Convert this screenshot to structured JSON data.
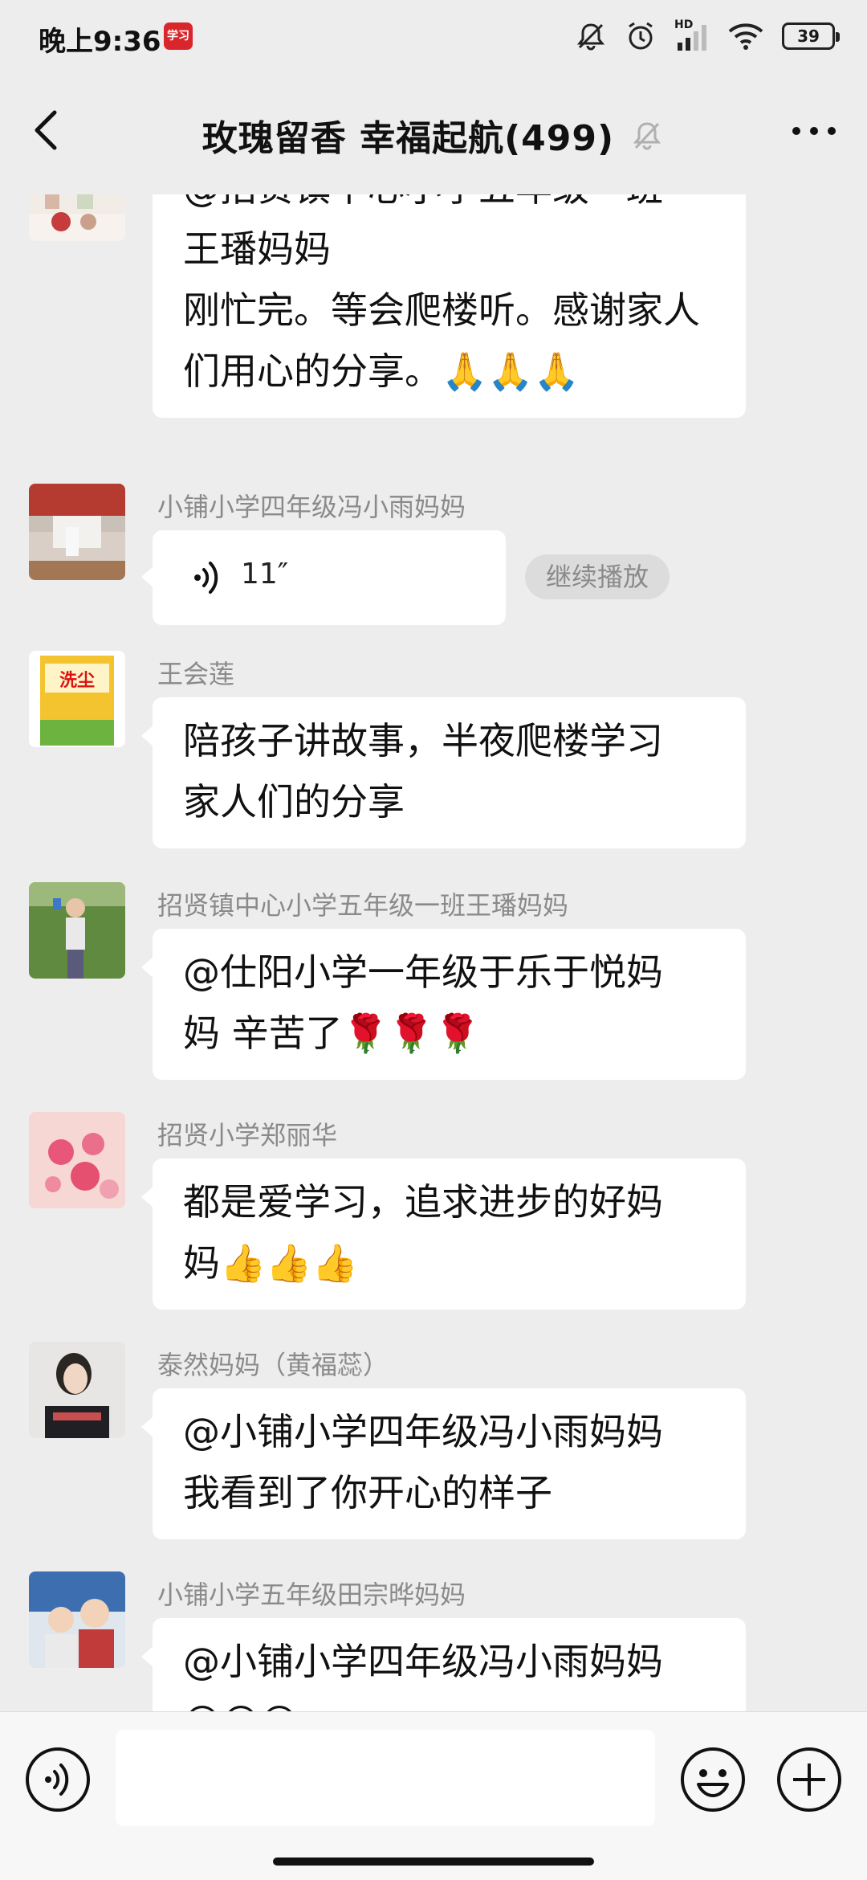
{
  "status_bar": {
    "time": "晚上9:36",
    "app_icon_text": "学习",
    "network_label": "HD",
    "battery": "39"
  },
  "header": {
    "title": "玫瑰留香  幸福起航(499)"
  },
  "messages": [
    {
      "sender": "",
      "lines": [
        "@招贤镇中心小学五年级一班",
        "王璠妈妈",
        "刚忙完。等会爬楼听。感谢家人",
        "们用心的分享。🙏🙏🙏"
      ]
    },
    {
      "sender": "小铺小学四年级冯小雨妈妈",
      "voice_duration": "11″",
      "continue_label": "继续播放"
    },
    {
      "sender": "王会莲",
      "avatar_text": "洗尘",
      "lines": [
        "陪孩子讲故事，半夜爬楼学习",
        "家人们的分享"
      ]
    },
    {
      "sender": "招贤镇中心小学五年级一班王璠妈妈",
      "lines": [
        "@仕阳小学一年级于乐于悦妈",
        "妈  辛苦了🌹🌹🌹"
      ]
    },
    {
      "sender": "招贤小学郑丽华",
      "lines": [
        "都是爱学习，追求进步的好妈",
        "妈👍👍👍"
      ]
    },
    {
      "sender": "泰然妈妈（黄福蕊）",
      "lines": [
        "@小铺小学四年级冯小雨妈妈",
        "我看到了你开心的样子"
      ]
    },
    {
      "sender": "小铺小学五年级田宗晔妈妈",
      "lines": [
        "@小铺小学四年级冯小雨妈妈",
        "😀😀😀"
      ]
    }
  ],
  "input_bar": {
    "placeholder": ""
  },
  "colors": {
    "background": "#ededed",
    "bubble": "#ffffff",
    "sender_name": "#8a8a8a"
  }
}
